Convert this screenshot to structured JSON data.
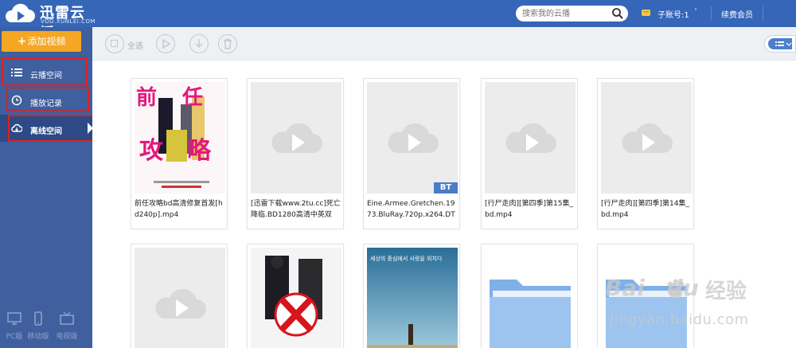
{
  "app": {
    "title": "迅雷云播",
    "subtitle": "VOD.XUNLEI.COM"
  },
  "header": {
    "search_placeholder": "搜索我的云播",
    "account_label": "子账号:1",
    "account_caret": "˅",
    "renew_label": "续费会员"
  },
  "sidebar": {
    "add_button_plus": "+",
    "add_button_label": "添加视频",
    "items": [
      {
        "label": "云播空间",
        "icon": "list-icon"
      },
      {
        "label": "播放记录",
        "icon": "clock-icon"
      },
      {
        "label": "离线空间",
        "icon": "cloud-download-icon",
        "active": true
      }
    ],
    "platforms": [
      {
        "label": "PC版",
        "icon": "monitor-icon"
      },
      {
        "label": "移动版",
        "icon": "phone-icon"
      },
      {
        "label": "电视版",
        "icon": "tv-icon"
      }
    ]
  },
  "toolbar": {
    "select_all_label": "全选"
  },
  "files": [
    {
      "name": "前任攻略bd高清修复首发[hd240p].mp4",
      "thumb": "poster-1",
      "bt": false
    },
    {
      "name": "[迅雷下载www.2tu.cc]死亡降临.BD1280高清中英双",
      "thumb": "placeholder",
      "bt": false
    },
    {
      "name": "Eine.Armee.Gretchen.1973.BluRay.720p.x264.DT",
      "thumb": "placeholder",
      "bt": true,
      "bt_label": "BT"
    },
    {
      "name": "[行尸走肉][第四季]第15集_bd.mp4",
      "thumb": "placeholder",
      "bt": false
    },
    {
      "name": "[行尸走肉][第四季]第14集_bd.mp4",
      "thumb": "placeholder",
      "bt": false
    },
    {
      "name": "",
      "thumb": "placeholder",
      "bt": false
    },
    {
      "name": "",
      "thumb": "poster-2",
      "bt": false
    },
    {
      "name": "",
      "thumb": "poster-3",
      "bt": false,
      "poster_text": "세상의 중심에서 사랑을 외치다"
    },
    {
      "name": "",
      "thumb": "folder",
      "bt": false
    },
    {
      "name": "",
      "thumb": "folder",
      "bt": false
    }
  ],
  "poster_1": {
    "title_chars": [
      "前",
      "任",
      "攻",
      "略"
    ]
  },
  "watermark": {
    "brand": "Bai",
    "brand2": "du",
    "jingyan": "经验",
    "url": "jingyan.baidu.com"
  },
  "colors": {
    "header_bg": "#3566b8",
    "sidebar_bg": "#3f5f9e",
    "sidebar_active_bg": "#2d4a86",
    "add_button": "#f5a623",
    "highlight_box": "#e0201d",
    "bt_badge": "#4a7cc7"
  }
}
